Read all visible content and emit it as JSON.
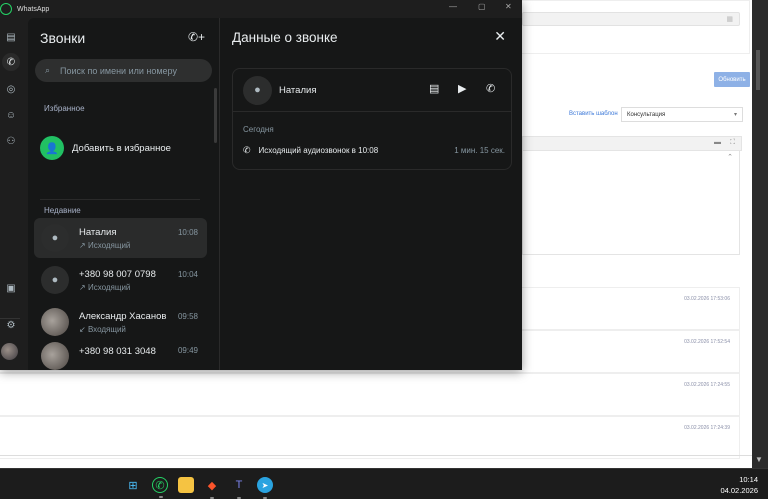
{
  "app": {
    "title": "WhatsApp"
  },
  "rail": {
    "items": [
      "chats",
      "calls",
      "status",
      "channels",
      "communities",
      "media",
      "settings",
      "profile"
    ]
  },
  "calls": {
    "title": "Звонки",
    "search_placeholder": "Поиск по имени или номеру",
    "favorites_header": "Избранное",
    "add_favorite": "Добавить в избранное",
    "recent_header": "Недавние",
    "items": [
      {
        "name": "Наталия",
        "type": "Исходящий",
        "time": "10:08",
        "selected": true
      },
      {
        "name": "+380 98 007 0798",
        "type": "Исходящий",
        "time": "10:04"
      },
      {
        "name": "Александр Хасанов",
        "type": "Входящий",
        "time": "09:58"
      },
      {
        "name": "+380 98 031 3048",
        "type": "",
        "time": "09:49"
      }
    ]
  },
  "detail": {
    "title": "Данные о звонке",
    "contact": "Наталия",
    "day": "Сегодня",
    "call_text": "Исходящий аудиозвонок в 10:08",
    "duration": "1 мин. 15 сек."
  },
  "background_page": {
    "update_button": "Обновить",
    "insert_template": "Вставить шаблон",
    "template_value": "Консультация",
    "timestamps": [
      "03.02.2026 17:53:06",
      "03.02.2026 17:52:54",
      "03.02.2026 17:24:55",
      "03.02.2026 17:24:39"
    ]
  },
  "taskbar": {
    "apps": [
      "start",
      "whatsapp",
      "file-explorer",
      "brave",
      "teams",
      "telegram"
    ],
    "time": "10:14",
    "date": "04.02.2026"
  },
  "colors": {
    "accent": "#21c063",
    "update_button": "#8eb1e6",
    "link": "#3b78d8"
  }
}
